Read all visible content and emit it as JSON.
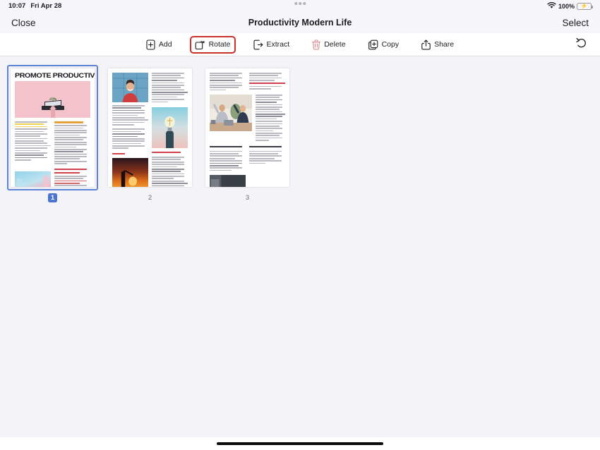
{
  "status_bar": {
    "time": "10:07",
    "date": "Fri Apr 28",
    "battery_percent": "100%",
    "wifi_icon": "wifi-icon",
    "battery_icon": "battery-charging-icon",
    "multitask_icon": "multitask-dots-icon"
  },
  "nav": {
    "close_label": "Close",
    "title": "Productivity Modern Life",
    "select_label": "Select"
  },
  "toolbar": {
    "highlight_color": "#c9302c",
    "items": [
      {
        "label": "Add",
        "icon": "add-page-icon",
        "highlighted": false
      },
      {
        "label": "Rotate",
        "icon": "rotate-icon",
        "highlighted": true
      },
      {
        "label": "Extract",
        "icon": "extract-icon",
        "highlighted": false
      },
      {
        "label": "Delete",
        "icon": "trash-icon",
        "highlighted": false
      },
      {
        "label": "Copy",
        "icon": "copy-icon",
        "highlighted": false
      },
      {
        "label": "Share",
        "icon": "share-icon",
        "highlighted": false
      }
    ],
    "undo_icon": "undo-icon"
  },
  "pages": [
    {
      "number": "1",
      "selected": true,
      "headline": "PROMOTE PRODUCTIVITY",
      "right_column_heading": "SUSTAINABLE FUTURE",
      "lower_heading": "REDUCE SCREEN TIME AND INCREASE SCREEN TIME FOCUS"
    },
    {
      "number": "2",
      "selected": false,
      "left_heading": "REPORTS",
      "right_heading": "RELEVANT WORKS"
    },
    {
      "number": "3",
      "selected": false,
      "top_right_heading": "LIABILITY INSURANCE",
      "left_heading": "MEASURE OF RESPONSIBLE AND COSTS",
      "right_heading": "CLIENT MORE ABOUT OUR PRODUCT"
    }
  ],
  "home_indicator": "home-bar"
}
